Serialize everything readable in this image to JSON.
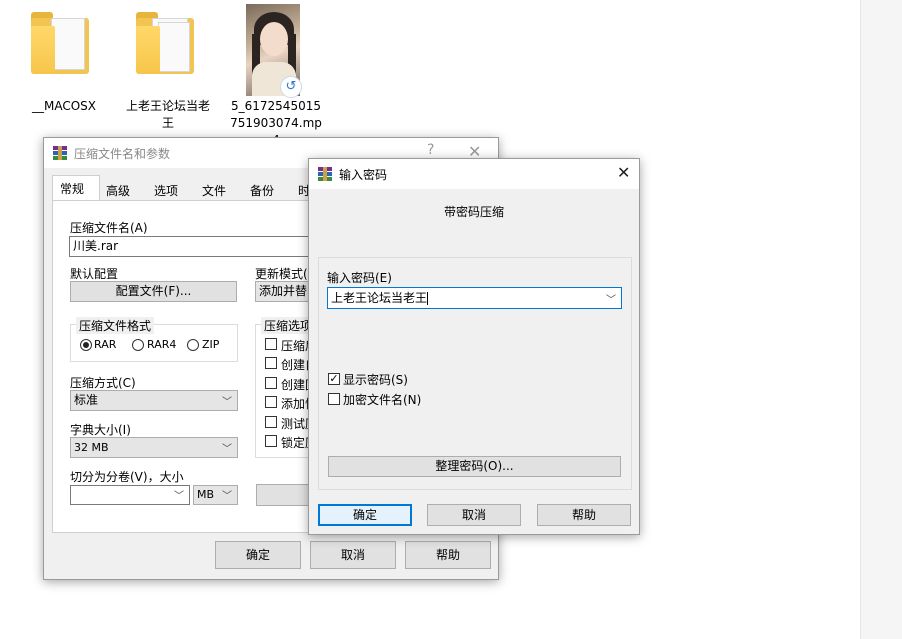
{
  "desktop": {
    "icons": [
      {
        "name": "__MACOSX"
      },
      {
        "name": "上老王论坛当老王"
      },
      {
        "name": "5_6172545015751903074.mp4"
      }
    ]
  },
  "compress_dialog": {
    "title": "压缩文件名和参数",
    "help_btn": "?",
    "close_btn": "✕",
    "tabs": [
      "常规",
      "高级",
      "选项",
      "文件",
      "备份",
      "时"
    ],
    "archive_name_label": "压缩文件名(A)",
    "archive_name_value": "川美.rar",
    "default_config_label": "默认配置",
    "config_button": "配置文件(F)...",
    "update_mode_label": "更新模式(",
    "update_mode_value": "添加并替",
    "format_group_title": "压缩文件格式",
    "formats": [
      "RAR",
      "RAR4",
      "ZIP"
    ],
    "selected_format": "RAR",
    "options_group_title": "压缩选项",
    "options": [
      "压缩后",
      "创建自",
      "创建固",
      "添加恢",
      "测试压",
      "锁定压"
    ],
    "method_label": "压缩方式(C)",
    "method_value": "标准",
    "dict_label": "字典大小(I)",
    "dict_value": "32 MB",
    "split_label": "切分为分卷(V)，大小",
    "split_value": "",
    "split_unit": "MB",
    "ok": "确定",
    "cancel": "取消",
    "help": "帮助"
  },
  "password_dialog": {
    "title": "输入密码",
    "close_btn": "✕",
    "heading": "带密码压缩",
    "password_label": "输入密码(E)",
    "password_value": "上老王论坛当老王",
    "show_password_label": "显示密码(S)",
    "show_password_checked": true,
    "encrypt_names_label": "加密文件名(N)",
    "encrypt_names_checked": false,
    "organize_button": "整理密码(O)...",
    "ok": "确定",
    "cancel": "取消",
    "help": "帮助"
  }
}
